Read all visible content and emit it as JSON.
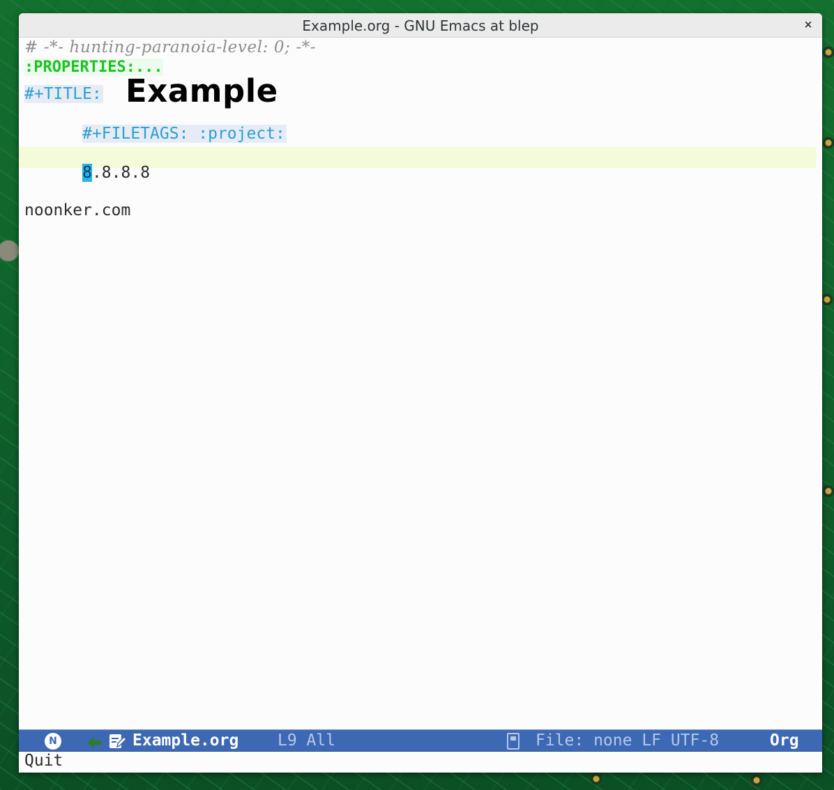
{
  "window": {
    "title": "Example.org - GNU Emacs at blep",
    "close_glyph": "×"
  },
  "buffer": {
    "modeline_comment": "# -*- hunting-paranoia-level: 0; -*-",
    "properties_drawer": ":PROPERTIES:...",
    "title_keyword": "#+TITLE:",
    "title_value": "Example",
    "filetags_keyword": "#+FILETAGS: :project:",
    "ip_cursor_char": "8",
    "ip_rest": ".8.8.8",
    "domain": "noonker.com"
  },
  "statusbar": {
    "state_badge": "N",
    "vcs_icon": "arrow-icon",
    "modified_icon": "edit-icon",
    "buffer_name": "Example.org",
    "position": "L9 All",
    "file_icon": "book-icon",
    "file_info": "File: none LF UTF-8",
    "mode": "Org"
  },
  "minibuffer": {
    "message": "Quit"
  },
  "colors": {
    "status_bg": "#3c68b4",
    "keyword": "#2aa0d0",
    "properties": "#19c422",
    "cursor": "#29b4e8",
    "line_highlight": "#f4fbd8"
  }
}
